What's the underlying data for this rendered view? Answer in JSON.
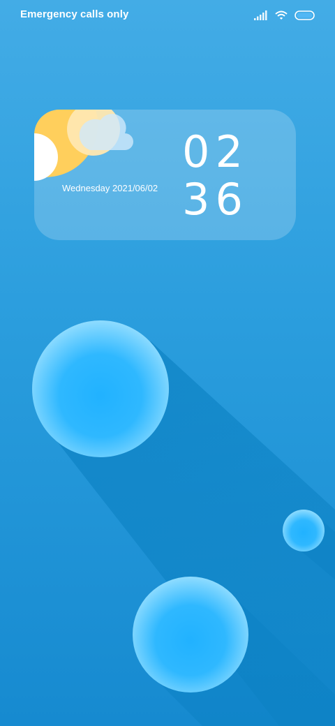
{
  "status_bar": {
    "carrier": "Emergency calls only",
    "icons": [
      "signal-icon",
      "wifi-icon",
      "battery-icon"
    ]
  },
  "widget": {
    "date": "Wednesday 2021/06/02",
    "hours": "02",
    "minutes": "36",
    "weather_icon": "partly-cloudy-icon"
  },
  "colors": {
    "background_top": "#43ace6",
    "background_bottom": "#168ad0",
    "sun": "#ffcf5c",
    "bubble": "#2ab4ff",
    "shadow": "#0f86c8"
  }
}
